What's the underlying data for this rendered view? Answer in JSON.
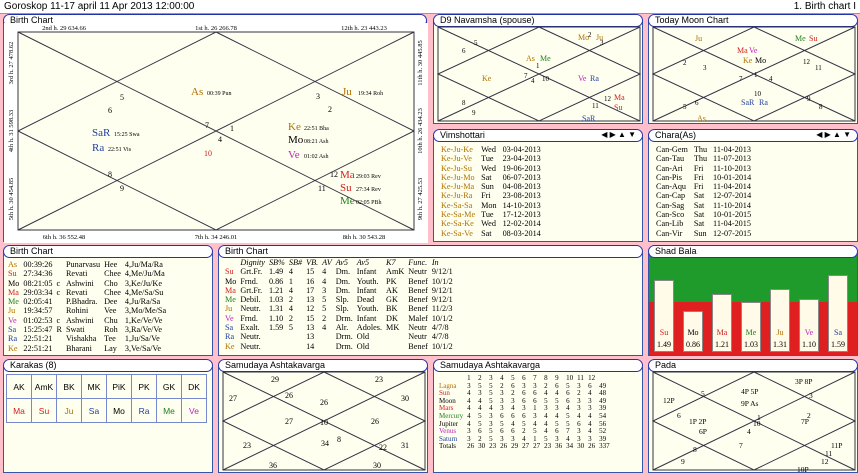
{
  "title": "Goroskop 11-17 april  11 Apr 2013 12:00:00",
  "title_right": "1. Birth chart I",
  "birth_chart": {
    "title": "Birth Chart",
    "top": [
      [
        "2nd h.",
        "29",
        "634.66"
      ],
      [
        "1st h.",
        "26",
        "266.78"
      ],
      [
        "12th h.",
        "23",
        "443.23"
      ]
    ],
    "bottom": [
      [
        "6th h.",
        "36",
        "552.48"
      ],
      [
        "7th h.",
        "34",
        "246.01"
      ],
      [
        "8th h.",
        "30",
        "543.28"
      ]
    ],
    "left": [
      "3rd h.  27  478.62",
      "4th h.  31  598.33",
      "5th h.  30  454.85"
    ],
    "right": [
      "11th h.  30  445.85",
      "10th h.  26  434.23",
      "9th h.  27  425.53"
    ],
    "signs": [
      "1",
      "2",
      "3",
      "4",
      "5",
      "6",
      "7",
      "8",
      "9",
      "10",
      "11",
      "12"
    ],
    "planets": [
      {
        "name": "As",
        "deg": "00:39",
        "nak": "Pun"
      },
      {
        "name": "Ju",
        "deg": "19:34",
        "nak": "Roh"
      },
      {
        "name": "SaR",
        "deg": "15:25",
        "nak": "Swa"
      },
      {
        "name": "Ra",
        "deg": "22:51",
        "nak": "Vis"
      },
      {
        "name": "Ke",
        "deg": "22:51",
        "nak": "Bha"
      },
      {
        "name": "Mo",
        "deg": "08:21",
        "nak": "Ash"
      },
      {
        "name": "Ve",
        "deg": "01:02",
        "nak": "Ash"
      },
      {
        "name": "Ma",
        "deg": "29:03",
        "nak": "Rev"
      },
      {
        "name": "Su",
        "deg": "27:34",
        "nak": "Rev"
      },
      {
        "name": "Me",
        "deg": "02:05",
        "nak": "PBh"
      }
    ]
  },
  "d9": {
    "title": "D9 Navamsha  (spouse)",
    "signs": [
      "1",
      "2",
      "3",
      "4",
      "5",
      "6",
      "7",
      "8",
      "9",
      "10",
      "11",
      "12"
    ],
    "planets": [
      "Mo",
      "Ju",
      "As",
      "Me",
      "Ke",
      "Ve",
      "Ra",
      "Ma",
      "Su",
      "SaR"
    ]
  },
  "moon_chart": {
    "title": "Today Moon Chart",
    "signs": [
      "1",
      "2",
      "3",
      "4",
      "5",
      "6",
      "7",
      "8",
      "9",
      "10",
      "11",
      "12"
    ],
    "planets": [
      "Ju",
      "Me",
      "Su",
      "Ma",
      "Ve",
      "Ke",
      "Mo",
      "SaR",
      "Ra",
      "As"
    ]
  },
  "vimshottari": {
    "title": "Vimshottari",
    "nav": "◀ ▶ ▲ ▼",
    "rows": [
      [
        "Ke-Ju-Ke",
        "Wed",
        "03-04-2013"
      ],
      [
        "Ke-Ju-Ve",
        "Tue",
        "23-04-2013"
      ],
      [
        "Ke-Ju-Su",
        "Wed",
        "19-06-2013"
      ],
      [
        "Ke-Ju-Mo",
        "Sat",
        "06-07-2013"
      ],
      [
        "Ke-Ju-Ma",
        "Sun",
        "04-08-2013"
      ],
      [
        "Ke-Ju-Ra",
        "Fri",
        "23-08-2013"
      ],
      [
        "Ke-Sa-Sa",
        "Mon",
        "14-10-2013"
      ],
      [
        "Ke-Sa-Me",
        "Tue",
        "17-12-2013"
      ],
      [
        "Ke-Sa-Ke",
        "Wed",
        "12-02-2014"
      ],
      [
        "Ke-Sa-Ve",
        "Sat",
        "08-03-2014"
      ]
    ]
  },
  "chara": {
    "title": "Chara(As)",
    "nav": "◀ ▶ ▲ ▼",
    "rows": [
      [
        "Can-Gem",
        "Thu",
        "11-04-2013"
      ],
      [
        "Can-Tau",
        "Thu",
        "11-07-2013"
      ],
      [
        "Can-Ari",
        "Fri",
        "11-10-2013"
      ],
      [
        "Can-Pis",
        "Fri",
        "10-01-2014"
      ],
      [
        "Can-Aqu",
        "Fri",
        "11-04-2014"
      ],
      [
        "Can-Cap",
        "Sat",
        "12-07-2014"
      ],
      [
        "Can-Sag",
        "Sat",
        "11-10-2014"
      ],
      [
        "Can-Sco",
        "Sat",
        "10-01-2015"
      ],
      [
        "Can-Lib",
        "Sat",
        "11-04-2015"
      ],
      [
        "Can-Vir",
        "Sun",
        "12-07-2015"
      ]
    ]
  },
  "birth_table": {
    "title": "Birth Chart",
    "rows": [
      [
        "As",
        "00:39:26",
        "",
        "Punarvasu",
        "Hee",
        "4,Ju/Ma/Ra"
      ],
      [
        "Su",
        "27:34:36",
        "",
        "Revati",
        "Chee",
        "4,Me/Ju/Ma"
      ],
      [
        "Mo",
        "08:21:05",
        "c",
        "Ashwini",
        "Cho",
        "3,Ke/Ju/Ke"
      ],
      [
        "Ma",
        "29:03:34",
        "c",
        "Revati",
        "Chee",
        "4,Me/Sa/Su"
      ],
      [
        "Me",
        "02:05:41",
        "",
        "P.Bhadra.",
        "Dee",
        "4,Ju/Ra/Sa"
      ],
      [
        "Ju",
        "19:34:57",
        "",
        "Rohini",
        "Vee",
        "3,Mo/Me/Sa"
      ],
      [
        "Ve",
        "01:02:53",
        "c",
        "Ashwini",
        "Chu",
        "1,Ke/Ve/Ve"
      ],
      [
        "Sa",
        "15:25:47",
        "R",
        "Swati",
        "Roh",
        "3,Ra/Ve/Ve"
      ],
      [
        "Ra",
        "22:51:21",
        "",
        "Vishakha",
        "Tee",
        "1,Ju/Sa/Ve"
      ],
      [
        "Ke",
        "22:51:21",
        "",
        "Bharani",
        "Lay",
        "3,Ve/Sa/Ve"
      ]
    ]
  },
  "dignity_table": {
    "title": "Birth Chart",
    "headers": [
      "",
      "Dignity",
      "SB%",
      "SB#",
      "VB.",
      "AV",
      "Av5",
      "Av5",
      "K7",
      "Func.",
      "In"
    ],
    "rows": [
      [
        "Su",
        "Grt.Fr.",
        "1.49",
        "4",
        "15",
        "4",
        "Dm.",
        "Infant",
        "AmK",
        "Neutr",
        "9/12/1"
      ],
      [
        "Mo",
        "Frnd.",
        "0.86",
        "1",
        "16",
        "4",
        "Dm.",
        "Youth.",
        "PK",
        "Benef",
        "10/1/2"
      ],
      [
        "Ma",
        "Grt.Fr.",
        "1.21",
        "4",
        "17",
        "3",
        "Dm.",
        "Infant",
        "AK",
        "Benef",
        "9/12/1"
      ],
      [
        "Me",
        "Debil.",
        "1.03",
        "2",
        "13",
        "5",
        "Slp.",
        "Dead",
        "GK",
        "Benef",
        "9/12/1"
      ],
      [
        "Ju",
        "Neutr.",
        "1.31",
        "4",
        "12",
        "5",
        "Slp.",
        "Youth.",
        "BK",
        "Benef",
        "11/2/3"
      ],
      [
        "Ve",
        "Frnd.",
        "1.10",
        "2",
        "15",
        "2",
        "Drm.",
        "Infant",
        "DK",
        "Malef",
        "10/1/2"
      ],
      [
        "Sa",
        "Exalt.",
        "1.59",
        "5",
        "13",
        "4",
        "Alr.",
        "Adoles.",
        "MK",
        "Neutr",
        "4/7/8"
      ],
      [
        "Ra",
        "Neutr.",
        "",
        "",
        "13",
        "",
        "Drm.",
        "Old",
        "",
        "Neutr",
        "4/7/8"
      ],
      [
        "Ke",
        "Neutr.",
        "",
        "",
        "14",
        "",
        "Drm.",
        "Old",
        "",
        "Benef",
        "10/1/2"
      ]
    ]
  },
  "shad_bala": {
    "title": "Shad Bala",
    "bars": [
      {
        "name": "Su",
        "value": 1.49
      },
      {
        "name": "Mo",
        "value": 0.86
      },
      {
        "name": "Ma",
        "value": 1.21
      },
      {
        "name": "Me",
        "value": 1.03
      },
      {
        "name": "Ju",
        "value": 1.31
      },
      {
        "name": "Ve",
        "value": 1.1
      },
      {
        "name": "Sa",
        "value": 1.59
      }
    ]
  },
  "karakas": {
    "title": "Karakas (8)",
    "headers": [
      "AK",
      "AmK",
      "BK",
      "MK",
      "PiK",
      "PK",
      "GK",
      "DK"
    ],
    "values": [
      "Ma",
      "Su",
      "Ju",
      "Sa",
      "Mo",
      "Ra",
      "Me",
      "Ve"
    ]
  },
  "samudaya_chart": {
    "title": "Samudaya Ashtakavarga",
    "values": [
      "29",
      "23",
      "27",
      "26",
      "26",
      "30",
      "27",
      "10",
      "26",
      "23",
      "8",
      "34",
      "22",
      "31",
      "36",
      "30"
    ]
  },
  "samudaya_table": {
    "title": "Samudaya Ashtakavarga",
    "header": [
      "1",
      "2",
      "3",
      "4",
      "5",
      "6",
      "7",
      "8",
      "9",
      "10",
      "11",
      "12"
    ],
    "rows": [
      {
        "label": "Lagna",
        "vals": [
          "3",
          "5",
          "5",
          "2",
          "6",
          "3",
          "3",
          "2",
          "6",
          "5",
          "3",
          "6"
        ],
        "total": "49"
      },
      {
        "label": "Sun",
        "vals": [
          "4",
          "3",
          "5",
          "3",
          "2",
          "6",
          "6",
          "4",
          "4",
          "6",
          "2",
          "4"
        ],
        "total": "48"
      },
      {
        "label": "Moon",
        "vals": [
          "4",
          "4",
          "5",
          "3",
          "3",
          "6",
          "6",
          "5",
          "5",
          "6",
          "3",
          "3"
        ],
        "total": "49"
      },
      {
        "label": "Mars",
        "vals": [
          "4",
          "4",
          "4",
          "3",
          "4",
          "3",
          "1",
          "3",
          "3",
          "4",
          "3",
          "3"
        ],
        "total": "39"
      },
      {
        "label": "Mercury",
        "vals": [
          "4",
          "5",
          "3",
          "6",
          "6",
          "6",
          "3",
          "4",
          "4",
          "5",
          "4",
          "4"
        ],
        "total": "54"
      },
      {
        "label": "Jupiter",
        "vals": [
          "4",
          "5",
          "3",
          "5",
          "4",
          "5",
          "4",
          "4",
          "5",
          "5",
          "6",
          "4"
        ],
        "total": "56"
      },
      {
        "label": "Venus",
        "vals": [
          "3",
          "6",
          "5",
          "6",
          "6",
          "2",
          "5",
          "4",
          "6",
          "7",
          "3",
          "4"
        ],
        "total": "52"
      },
      {
        "label": "Saturn",
        "vals": [
          "3",
          "2",
          "5",
          "3",
          "3",
          "4",
          "1",
          "5",
          "3",
          "4",
          "3",
          "3"
        ],
        "total": "39"
      },
      {
        "label": "Totals",
        "vals": [
          "26",
          "30",
          "23",
          "26",
          "29",
          "27",
          "27",
          "23",
          "36",
          "34",
          "30",
          "26"
        ],
        "total": "337"
      }
    ]
  },
  "pada": {
    "title": "Pada",
    "labels": [
      "4P 5P",
      "9P As",
      "3P 8P",
      "12P",
      "6",
      "1P 2P",
      "6P",
      "7P",
      "10",
      "4",
      "1",
      "7",
      "8",
      "9",
      "2",
      "3",
      "5",
      "11",
      "11P",
      "10P",
      "12"
    ]
  },
  "colors": {
    "red": "#d02020",
    "blue": "#2040a0",
    "brown": "#b07000",
    "green": "#208020",
    "magenta": "#c020c0",
    "shad_green": "#1f9b2c",
    "shad_red": "#e02020"
  }
}
